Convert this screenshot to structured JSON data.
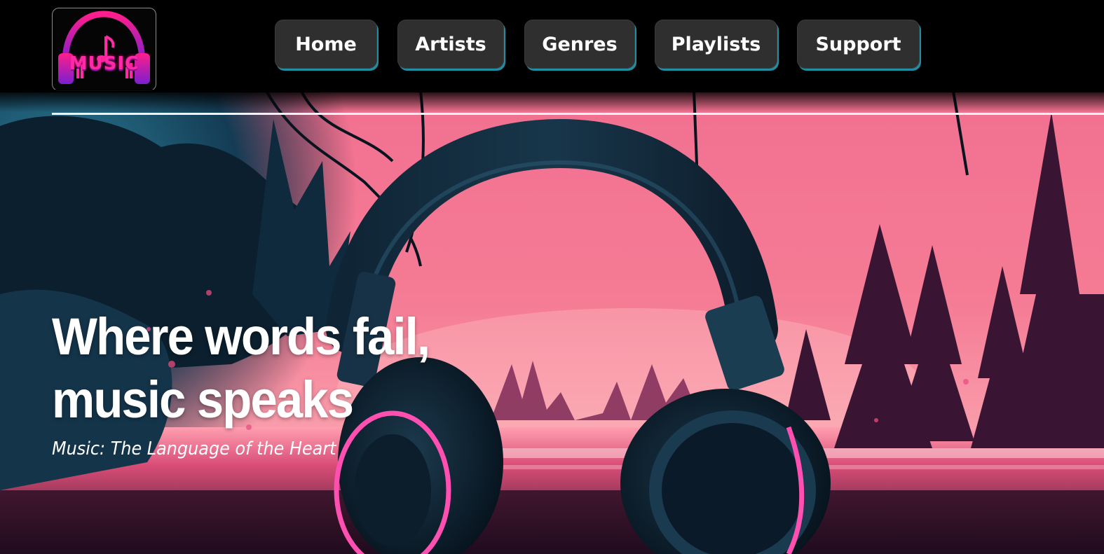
{
  "brand": {
    "logo_text": "MUSIC",
    "logo_icon": "headphones-logo-icon"
  },
  "nav": {
    "items": [
      {
        "label": "Home"
      },
      {
        "label": "Artists"
      },
      {
        "label": "Genres"
      },
      {
        "label": "Playlists"
      },
      {
        "label": "Support"
      }
    ]
  },
  "hero": {
    "headline_line1": "Where words fail,",
    "headline_line2": "music speaks",
    "tagline": "Music: The Language of the Heart",
    "image_icon": "headphones-forest-illustration"
  },
  "colors": {
    "header_bg": "#000000",
    "nav_button_bg": "#2f2f2f",
    "nav_button_accent": "#1e8fa3",
    "logo_pink": "#ff2aa6",
    "logo_purple": "#5a1aa8",
    "sky_pink": "#f4708f",
    "forest_teal": "#1c5b73",
    "text_white": "#ffffff"
  }
}
